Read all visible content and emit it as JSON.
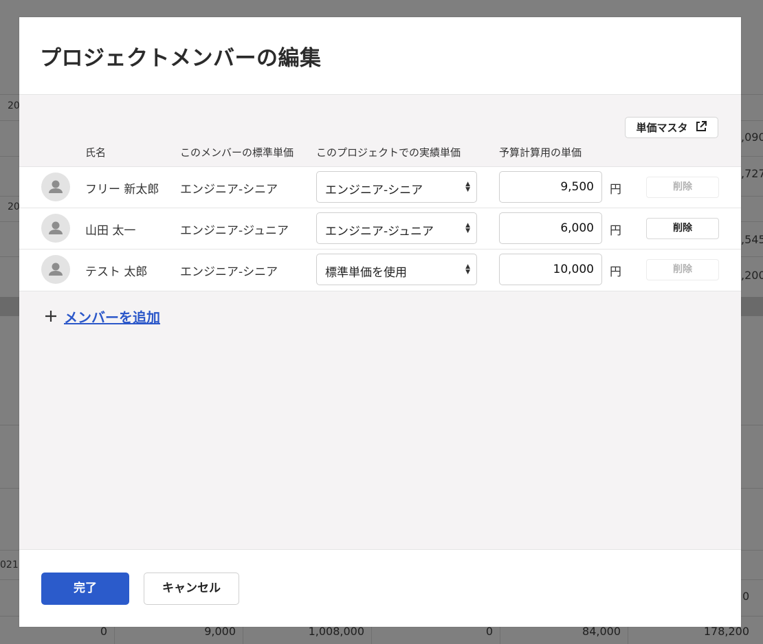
{
  "background": {
    "left_fragments": [
      "20",
      "20",
      "021"
    ],
    "right_fragments": [
      ",090",
      ",727",
      ",545",
      ",200",
      "0"
    ],
    "bottom_row": [
      "0",
      "9,000",
      "1,008,000",
      "0",
      "84,000",
      "178,200"
    ]
  },
  "modal": {
    "title": "プロジェクトメンバーの編集",
    "master_button": {
      "label": "単価マスタ",
      "icon": "external-link-icon"
    },
    "columns": [
      "氏名",
      "このメンバーの標準単価",
      "このプロジェクトでの実績単価",
      "予算計算用の単価"
    ],
    "members": [
      {
        "name": "フリー 新太郎",
        "standard_rate": "エンジニア-シニア",
        "project_rate": "エンジニア-シニア",
        "budget_rate": "9,500",
        "unit": "円",
        "delete_label": "削除",
        "delete_enabled": false
      },
      {
        "name": "山田 太一",
        "standard_rate": "エンジニア-ジュニア",
        "project_rate": "エンジニア-ジュニア",
        "budget_rate": "6,000",
        "unit": "円",
        "delete_label": "削除",
        "delete_enabled": true
      },
      {
        "name": "テスト 太郎",
        "standard_rate": "エンジニア-シニア",
        "project_rate": "標準単価を使用",
        "budget_rate": "10,000",
        "unit": "円",
        "delete_label": "削除",
        "delete_enabled": false
      }
    ],
    "add_member": {
      "icon": "plus-icon",
      "label": "メンバーを追加"
    },
    "footer": {
      "done_label": "完了",
      "cancel_label": "キャンセル"
    }
  },
  "colors": {
    "accent": "#2b5bcb",
    "link": "#2b57c9",
    "overlay": "#7f7f7f"
  }
}
